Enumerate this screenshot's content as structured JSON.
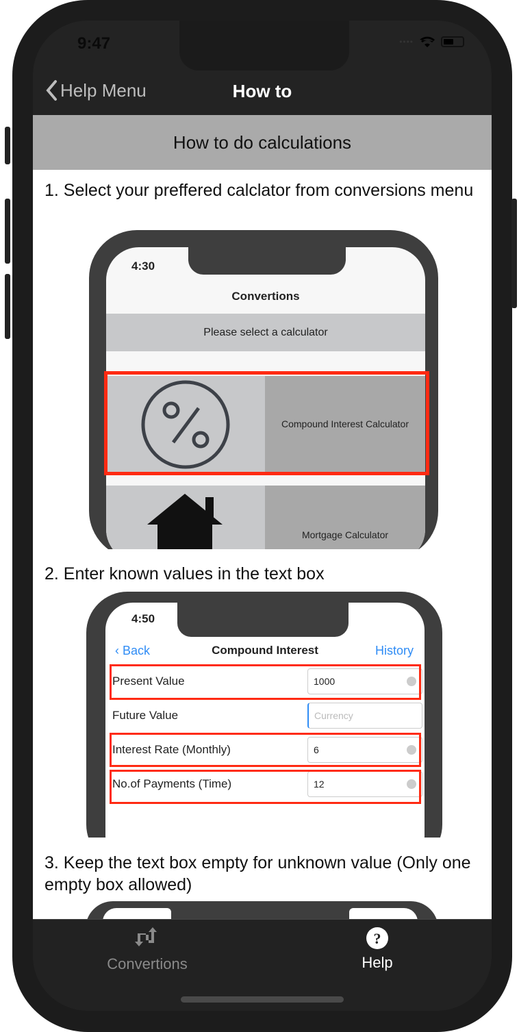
{
  "status": {
    "time": "9:47"
  },
  "nav": {
    "back_label": "Help Menu",
    "title": "How to"
  },
  "header": "How to do calculations",
  "steps": [
    "1. Select your preffered calclator from conversions menu",
    "2. Enter known values in the text box",
    "3. Keep the text box empty for unknown value (Only one empty box allowed)"
  ],
  "shot1": {
    "time": "4:30",
    "title": "Convertions",
    "banner": "Please select a calculator",
    "items": [
      "Compound Interest Calculator",
      "Mortgage Calculator"
    ]
  },
  "shot2": {
    "time": "4:50",
    "back": "Back",
    "title": "Compound Interest",
    "history": "History",
    "fields": [
      {
        "label": "Present Value",
        "value": "1000"
      },
      {
        "label": "Future Value",
        "placeholder": "Currency"
      },
      {
        "label": "Interest Rate (Monthly)",
        "value": "6"
      },
      {
        "label": "No.of Payments (Time)",
        "value": "12"
      }
    ]
  },
  "tabs": [
    {
      "label": "Convertions",
      "icon": "arrows-exchange-icon",
      "active": false
    },
    {
      "label": "Help",
      "icon": "question-circle-icon",
      "active": true
    }
  ],
  "colors": {
    "highlight": "#ff2a12",
    "ios_blue": "#2f8cf5",
    "tab_active": "#ffffff",
    "tab_inactive": "#8a8a8a"
  }
}
